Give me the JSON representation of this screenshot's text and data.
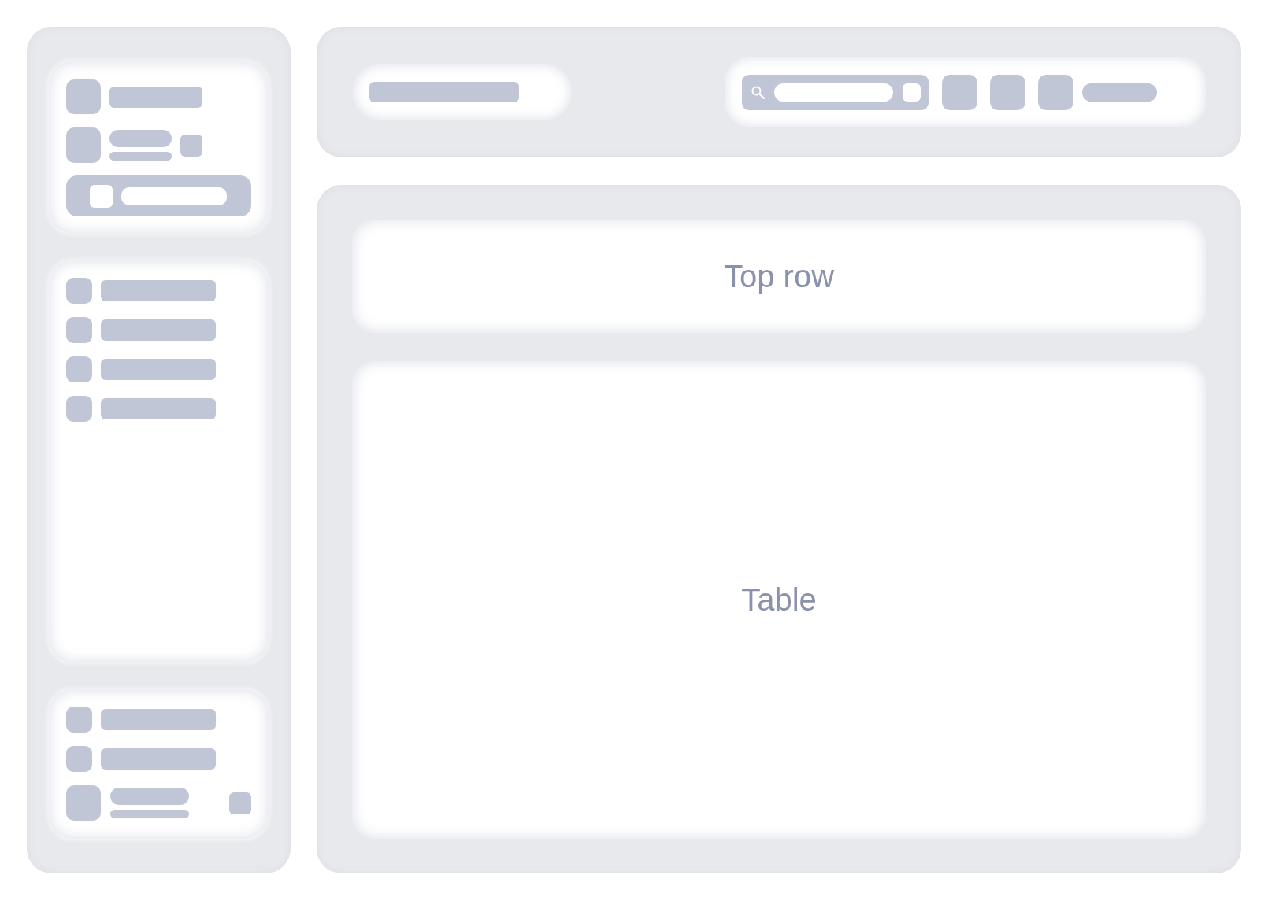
{
  "top_row": {
    "label": "Top row"
  },
  "table": {
    "label": "Table"
  }
}
